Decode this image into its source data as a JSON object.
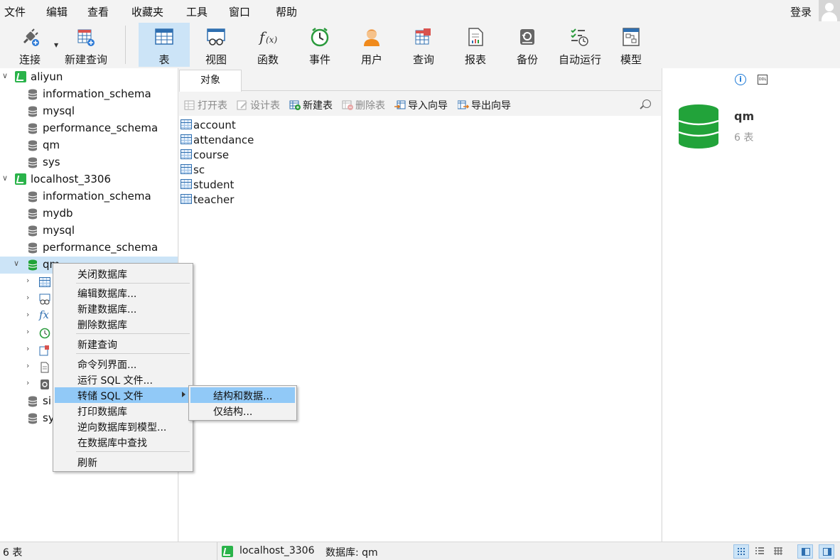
{
  "menubar": {
    "items": [
      "文件",
      "编辑",
      "查看",
      "收藏夹",
      "工具",
      "窗口",
      "帮助"
    ],
    "login": "登录"
  },
  "toolbar": {
    "buttons": [
      {
        "label": "连接",
        "icon": "plug-icon"
      },
      {
        "label": "新建查询",
        "icon": "new-query-icon"
      },
      {
        "label": "表",
        "icon": "table-icon",
        "active": true
      },
      {
        "label": "视图",
        "icon": "view-icon"
      },
      {
        "label": "函数",
        "icon": "function-icon"
      },
      {
        "label": "事件",
        "icon": "clock-icon"
      },
      {
        "label": "用户",
        "icon": "user-icon"
      },
      {
        "label": "查询",
        "icon": "query-icon"
      },
      {
        "label": "报表",
        "icon": "report-icon"
      },
      {
        "label": "备份",
        "icon": "backup-icon"
      },
      {
        "label": "自动运行",
        "icon": "schedule-icon"
      },
      {
        "label": "模型",
        "icon": "model-icon"
      }
    ]
  },
  "tree": {
    "connections": [
      {
        "name": "aliyun",
        "databases": [
          "information_schema",
          "mysql",
          "performance_schema",
          "qm",
          "sys"
        ]
      },
      {
        "name": "localhost_3306",
        "databases": [
          "information_schema",
          "mydb",
          "mysql",
          "performance_schema",
          "qm",
          "si",
          "sy"
        ]
      }
    ]
  },
  "tabs": {
    "objects": "对象"
  },
  "objbar": {
    "open_table": "打开表",
    "design_table": "设计表",
    "new_table": "新建表",
    "delete_table": "删除表",
    "import_wizard": "导入向导",
    "export_wizard": "导出向导"
  },
  "tables": [
    "account",
    "attendance",
    "course",
    "sc",
    "student",
    "teacher"
  ],
  "info": {
    "name": "qm",
    "count": "6 表"
  },
  "context_menu": {
    "items": [
      "关闭数据库",
      "编辑数据库...",
      "新建数据库...",
      "删除数据库",
      "新建查询",
      "命令列界面...",
      "运行 SQL 文件...",
      "转储 SQL 文件",
      "打印数据库",
      "逆向数据库到模型...",
      "在数据库中查找",
      "刷新"
    ],
    "submenu": [
      "结构和数据...",
      "仅结构..."
    ]
  },
  "status": {
    "count": "6 表",
    "connection": "localhost_3306",
    "database": "数据库: qm"
  },
  "colors": {
    "accent": "#cce4f7",
    "highlight": "#91c9f7",
    "db_green": "#22a33a"
  }
}
